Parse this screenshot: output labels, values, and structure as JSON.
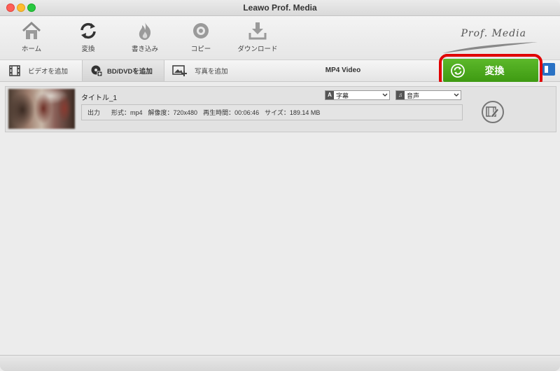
{
  "window": {
    "title": "Leawo Prof. Media"
  },
  "toolbar": {
    "items": [
      {
        "label": "ホーム",
        "icon": "home-icon"
      },
      {
        "label": "変換",
        "icon": "convert-icon"
      },
      {
        "label": "書き込み",
        "icon": "burn-icon"
      },
      {
        "label": "コピー",
        "icon": "copy-disc-icon"
      },
      {
        "label": "ダウンロード",
        "icon": "download-icon"
      }
    ],
    "brand": "Prof. Media"
  },
  "subbar": {
    "add_video": "ビデオを追加",
    "add_bd_dvd": "BD/DVDを追加",
    "add_photo": "写真を追加",
    "format": "MP4 Video",
    "convert": "変換"
  },
  "item": {
    "title": "タイトル_1",
    "subtitle_select": "字幕",
    "audio_select": "音声",
    "info": {
      "output": "出力",
      "format": "形式：mp4",
      "resolution": "解像度：720x480",
      "duration": "再生時間：00:06:46",
      "size": "サイズ：189.14 MB"
    }
  },
  "colors": {
    "convert_green": "#4caa1e",
    "highlight_red": "#e00000",
    "accent_blue": "#2a72c4"
  }
}
